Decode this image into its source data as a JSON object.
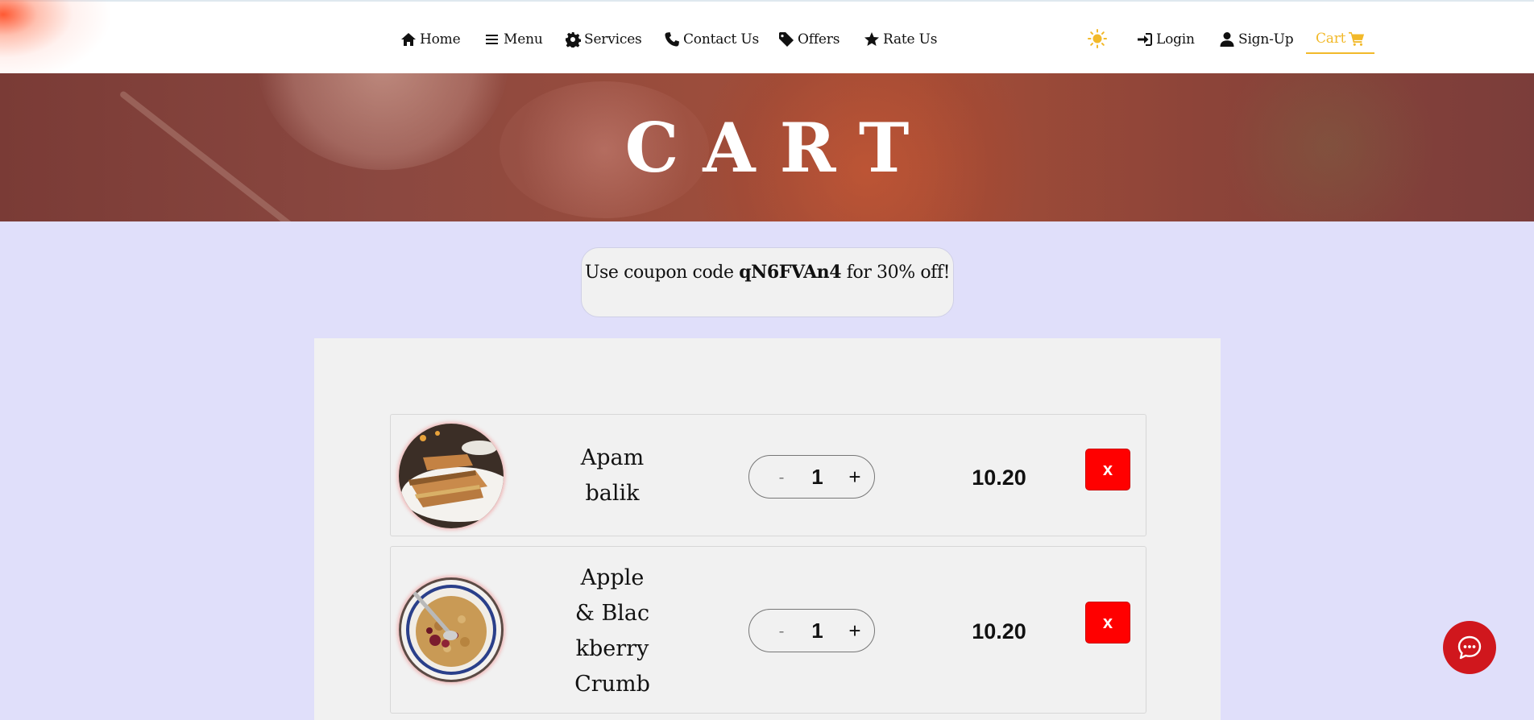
{
  "nav": {
    "items": [
      {
        "label": "Home",
        "icon": "home-icon"
      },
      {
        "label": "Menu",
        "icon": "bars-icon"
      },
      {
        "label": "Services",
        "icon": "gear-icon"
      },
      {
        "label": "Contact Us",
        "icon": "phone-icon"
      },
      {
        "label": "Offers",
        "icon": "tag-icon"
      },
      {
        "label": "Rate Us",
        "icon": "star-icon"
      }
    ],
    "theme_icon": "sun-icon",
    "login": "Login",
    "signup": "Sign-Up",
    "cart": "Cart",
    "accent_color": "#f2b92a"
  },
  "hero": {
    "title": "CART"
  },
  "coupon": {
    "prefix": "Use coupon code ",
    "code": "qN6FVAn4",
    "suffix": " for 30% off!"
  },
  "cart": {
    "items": [
      {
        "name": "Apam balik",
        "quantity": "1",
        "price": "10.20",
        "decrease": "-",
        "increase": "+",
        "remove": "x"
      },
      {
        "name": "Apple & Blackberry Crumble",
        "quantity": "1",
        "price": "10.20",
        "decrease": "-",
        "increase": "+",
        "remove": "x"
      }
    ],
    "remove_color": "#ff0000"
  },
  "chat": {
    "icon": "chat-icon",
    "color": "#d0171d"
  }
}
